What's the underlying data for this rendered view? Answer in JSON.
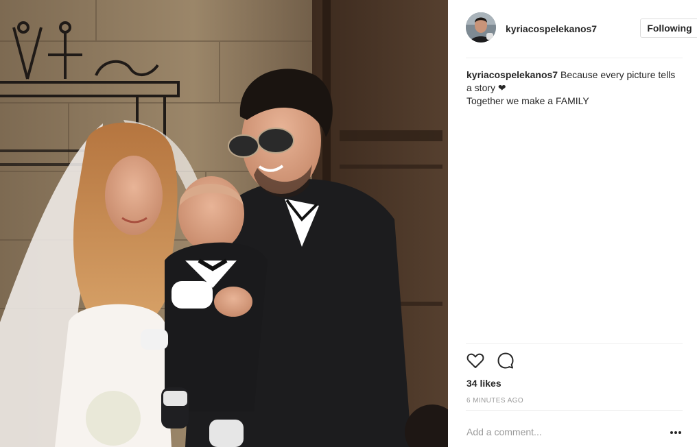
{
  "post": {
    "username": "kyriacospelekanos7",
    "follow_label": "Following",
    "caption_user": "kyriacospelekanos7",
    "caption_line1": "Because every picture tells a story",
    "caption_line2": "Together we make a FAMILY",
    "likes": "34 likes",
    "timestamp": "6 MINUTES AGO",
    "comment_placeholder": "Add a comment..."
  },
  "icons": {
    "heart": "heart-icon",
    "comment": "comment-icon",
    "more": "more-options-icon",
    "caption_heart": "black-heart-icon"
  },
  "colors": {
    "text": "#262626",
    "muted": "#999999",
    "border": "#dbdbdb",
    "divider": "#efefef"
  }
}
